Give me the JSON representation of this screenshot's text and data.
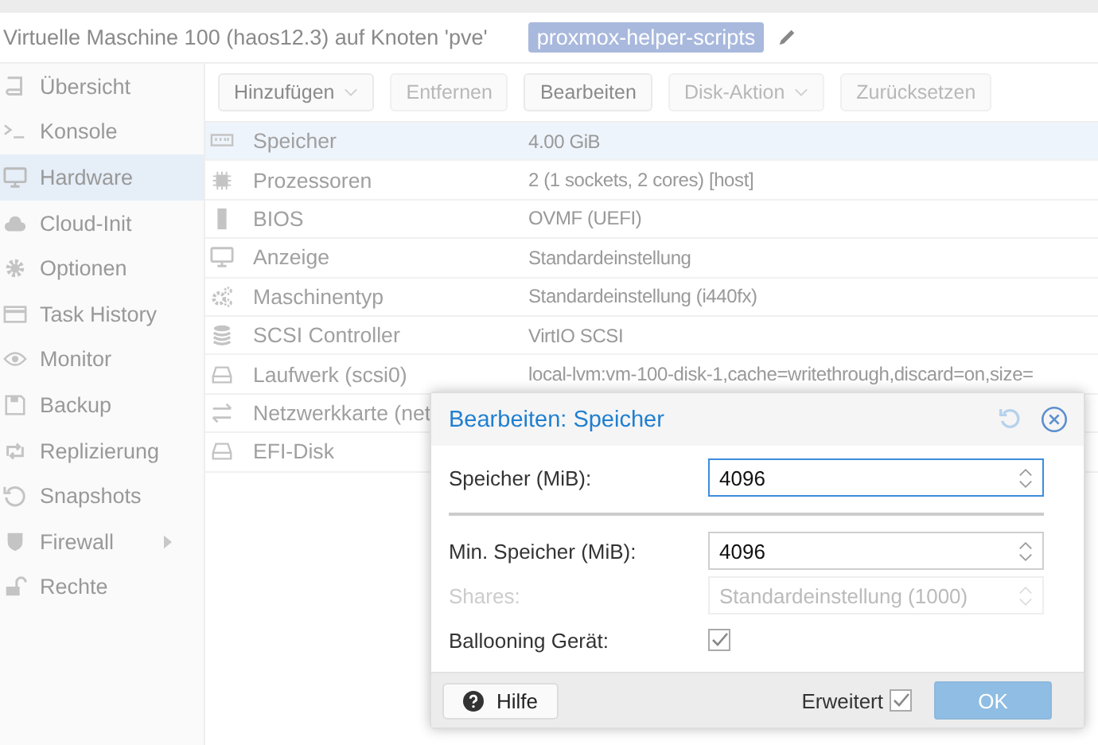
{
  "header": {
    "title": "Virtuelle Maschine 100 (haos12.3) auf Knoten 'pve'",
    "tag": "proxmox-helper-scripts"
  },
  "sidebar": {
    "items": [
      {
        "label": "Übersicht",
        "selected": false,
        "expandable": false
      },
      {
        "label": "Konsole",
        "selected": false,
        "expandable": false
      },
      {
        "label": "Hardware",
        "selected": true,
        "expandable": false
      },
      {
        "label": "Cloud-Init",
        "selected": false,
        "expandable": false
      },
      {
        "label": "Optionen",
        "selected": false,
        "expandable": false
      },
      {
        "label": "Task History",
        "selected": false,
        "expandable": false
      },
      {
        "label": "Monitor",
        "selected": false,
        "expandable": false
      },
      {
        "label": "Backup",
        "selected": false,
        "expandable": false
      },
      {
        "label": "Replizierung",
        "selected": false,
        "expandable": false
      },
      {
        "label": "Snapshots",
        "selected": false,
        "expandable": false
      },
      {
        "label": "Firewall",
        "selected": false,
        "expandable": true
      },
      {
        "label": "Rechte",
        "selected": false,
        "expandable": false
      }
    ]
  },
  "toolbar": [
    {
      "label": "Hinzufügen",
      "disabled": false,
      "dropdown": true
    },
    {
      "label": "Entfernen",
      "disabled": true,
      "dropdown": false
    },
    {
      "label": "Bearbeiten",
      "disabled": false,
      "dropdown": false
    },
    {
      "label": "Disk-Aktion",
      "disabled": true,
      "dropdown": true
    },
    {
      "label": "Zurücksetzen",
      "disabled": true,
      "dropdown": false
    }
  ],
  "hardware": [
    {
      "name": "Speicher",
      "value": "4.00 GiB",
      "selected": true
    },
    {
      "name": "Prozessoren",
      "value": "2 (1 sockets, 2 cores) [host]",
      "selected": false
    },
    {
      "name": "BIOS",
      "value": "OVMF (UEFI)",
      "selected": false
    },
    {
      "name": "Anzeige",
      "value": "Standardeinstellung",
      "selected": false
    },
    {
      "name": "Maschinentyp",
      "value": "Standardeinstellung (i440fx)",
      "selected": false
    },
    {
      "name": "SCSI Controller",
      "value": "VirtIO SCSI",
      "selected": false
    },
    {
      "name": "Laufwerk (scsi0)",
      "value": "local-lvm:vm-100-disk-1,cache=writethrough,discard=on,size=",
      "selected": false
    },
    {
      "name": "Netzwerkkarte (net",
      "selected": false
    },
    {
      "name": "EFI-Disk",
      "selected": false
    }
  ],
  "dialog": {
    "title": "Bearbeiten: Speicher",
    "fields": [
      {
        "kind": "number",
        "label": "Speicher (MiB):",
        "value": "4096",
        "focused": true,
        "disabled": false
      },
      {
        "kind": "separator"
      },
      {
        "kind": "number",
        "label": "Min. Speicher (MiB):",
        "value": "4096",
        "focused": false,
        "disabled": false
      },
      {
        "kind": "number",
        "label": "Shares:",
        "placeholder": "Standardeinstellung (1000)",
        "focused": false,
        "disabled": true
      },
      {
        "kind": "checkbox",
        "label": "Ballooning Gerät:",
        "checked": true
      }
    ],
    "help_button": "Hilfe",
    "advanced": {
      "label": "Erweitert",
      "checked": true
    },
    "ok_button": {
      "label": "OK",
      "disabled": true
    }
  }
}
